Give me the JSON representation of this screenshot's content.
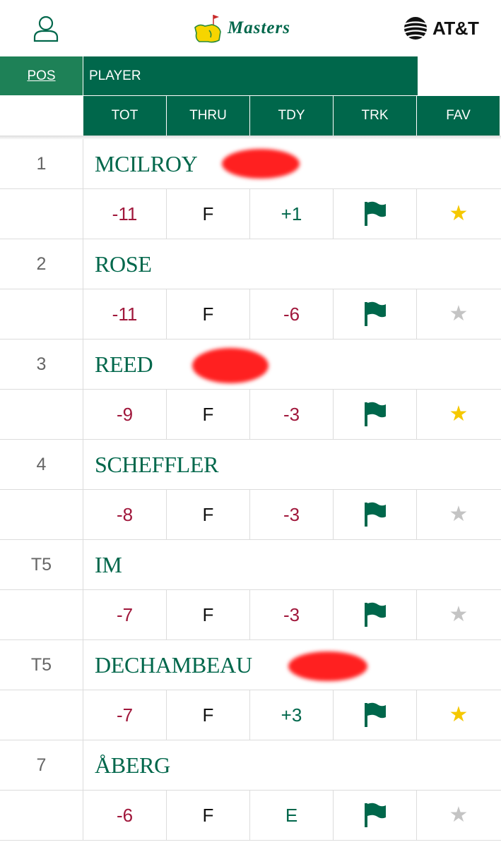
{
  "header": {
    "logo_text": "Masters",
    "sponsor": "AT&T"
  },
  "table_header": {
    "pos": "POS",
    "player": "PLAYER",
    "columns": [
      "TOT",
      "THRU",
      "TDY",
      "TRK",
      "FAV"
    ]
  },
  "colors": {
    "green": "#00674b",
    "light_green": "#1e8157",
    "score_red": "#a0173b",
    "star_active": "#f5c800",
    "star_inactive": "#c4c4c4"
  },
  "players": [
    {
      "pos": "1",
      "name": "MCILROY",
      "tot": "-11",
      "tot_color": "red",
      "thru": "F",
      "tdy": "+1",
      "tdy_color": "green",
      "track_icon": "flag-icon",
      "favorite": true,
      "redacted": true
    },
    {
      "pos": "2",
      "name": "ROSE",
      "tot": "-11",
      "tot_color": "red",
      "thru": "F",
      "tdy": "-6",
      "tdy_color": "red",
      "track_icon": "flag-icon",
      "favorite": false,
      "redacted": false
    },
    {
      "pos": "3",
      "name": "REED",
      "tot": "-9",
      "tot_color": "red",
      "thru": "F",
      "tdy": "-3",
      "tdy_color": "red",
      "track_icon": "flag-icon",
      "favorite": true,
      "redacted": true
    },
    {
      "pos": "4",
      "name": "SCHEFFLER",
      "tot": "-8",
      "tot_color": "red",
      "thru": "F",
      "tdy": "-3",
      "tdy_color": "red",
      "track_icon": "flag-icon",
      "favorite": false,
      "redacted": false
    },
    {
      "pos": "T5",
      "name": "IM",
      "tot": "-7",
      "tot_color": "red",
      "thru": "F",
      "tdy": "-3",
      "tdy_color": "red",
      "track_icon": "flag-icon",
      "favorite": false,
      "redacted": false
    },
    {
      "pos": "T5",
      "name": "DECHAMBEAU",
      "tot": "-7",
      "tot_color": "red",
      "thru": "F",
      "tdy": "+3",
      "tdy_color": "green",
      "track_icon": "flag-icon",
      "favorite": true,
      "redacted": true
    },
    {
      "pos": "7",
      "name": "ÅBERG",
      "tot": "-6",
      "tot_color": "red",
      "thru": "F",
      "tdy": "E",
      "tdy_color": "green",
      "track_icon": "flag-icon",
      "favorite": false,
      "redacted": false
    }
  ]
}
